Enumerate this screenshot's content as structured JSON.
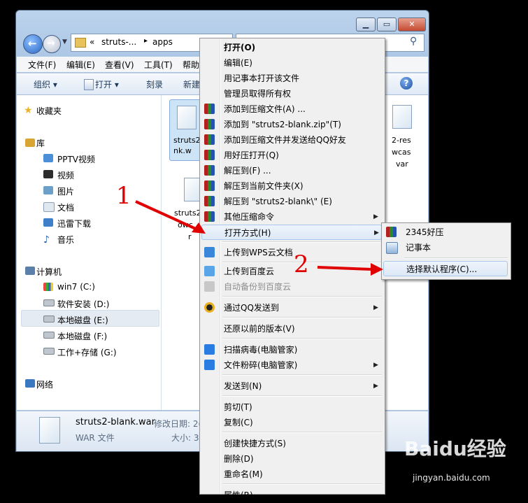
{
  "breadcrumb": {
    "chevron": "«",
    "folder_parent": "struts-...",
    "arrow": "▸",
    "folder_current": "apps"
  },
  "menubar": [
    "文件(F)",
    "编辑(E)",
    "查看(V)",
    "工具(T)",
    "帮助"
  ],
  "toolbar": {
    "organize": "组织 ▾",
    "open": "打开 ▾",
    "burn": "刻录",
    "new": "新建"
  },
  "sidebar": {
    "favorites": "收藏夹",
    "libraries": "库",
    "lib_items": [
      "PPTV视频",
      "视频",
      "图片",
      "文档",
      "迅雷下载",
      "音乐"
    ],
    "computer": "计算机",
    "drives": [
      "win7 (C:)",
      "软件安装 (D:)",
      "本地磁盘 (E:)",
      "本地磁盘 (F:)",
      "工作+存储 (G:)"
    ],
    "network": "网络"
  },
  "files": {
    "f1": [
      "struts2",
      "nk.w"
    ],
    "f2": [
      "struts2",
      "owc",
      "r"
    ],
    "f3": [
      "2-res",
      "wcas",
      "var"
    ]
  },
  "details": {
    "name": "struts2-blank.war",
    "type": "WAR 文件",
    "modified_label": "修改日期: 2(",
    "size_label": "大小: 3"
  },
  "context_menu": {
    "open": "打开(O)",
    "edit": "编辑(E)",
    "notepad": "用记事本打开该文件",
    "admin": "管理员取得所有权",
    "add_archive": "添加到压缩文件(A) ...",
    "add_zip": "添加到 \"struts2-blank.zip\"(T)",
    "add_qq": "添加到压缩文件并发送给QQ好友",
    "haozip": "用好压打开(Q)",
    "extract": "解压到(F) ...",
    "extract_here": "解压到当前文件夹(X)",
    "extract_folder": "解压到 \"struts2-blank\\\" (E)",
    "other_cmd": "其他压缩命令",
    "open_with": "打开方式(H)",
    "wps": "上传到WPS云文档",
    "baidu": "上传到百度云",
    "auto_backup": "自动备份到百度云",
    "qq_send": "通过QQ发送到",
    "restore": "还原以前的版本(V)",
    "scan": "扫描病毒(电脑管家)",
    "shred": "文件粉碎(电脑管家)",
    "send_to": "发送到(N)",
    "cut": "剪切(T)",
    "copy": "复制(C)",
    "shortcut": "创建快捷方式(S)",
    "delete": "删除(D)",
    "rename": "重命名(M)",
    "properties": "属性(R)"
  },
  "submenu": {
    "haozip2345": "2345好压",
    "notepad": "记事本",
    "choose_default": "选择默认程序(C)..."
  },
  "annotations": {
    "one": "1",
    "two": "2"
  },
  "watermark": {
    "logo": "Baidu经验",
    "url": "jingyan.baidu.com"
  },
  "colors": {
    "annotation": "#e00000",
    "highlight": "#dde9f7"
  }
}
